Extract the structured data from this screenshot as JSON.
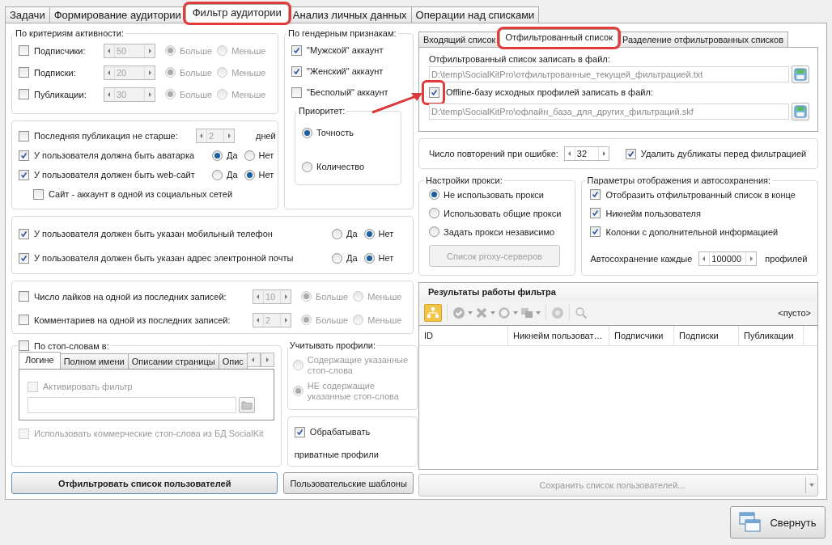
{
  "main_tabs": [
    {
      "label": "Задачи",
      "selected": false,
      "highlighted": false
    },
    {
      "label": "Формирование аудитории",
      "selected": false,
      "highlighted": false
    },
    {
      "label": "Фильтр аудитории",
      "selected": true,
      "highlighted": true
    },
    {
      "label": "Анализ личных данных",
      "selected": false,
      "highlighted": false
    },
    {
      "label": "Операции над списками",
      "selected": false,
      "highlighted": false
    }
  ],
  "activity": {
    "title": "По критериям активности:",
    "rows": [
      {
        "label": "Подписчики:",
        "checked": false,
        "value": "50",
        "options": [
          {
            "label": "Больше",
            "selected": true
          },
          {
            "label": "Меньше",
            "selected": false
          }
        ]
      },
      {
        "label": "Подписки:",
        "checked": false,
        "value": "20",
        "options": [
          {
            "label": "Больше",
            "selected": true
          },
          {
            "label": "Меньше",
            "selected": false
          }
        ]
      },
      {
        "label": "Публикации:",
        "checked": false,
        "value": "30",
        "options": [
          {
            "label": "Больше",
            "selected": true
          },
          {
            "label": "Меньше",
            "selected": false
          }
        ]
      }
    ]
  },
  "profile_rules": {
    "rows": [
      {
        "kind": "spinner",
        "label": "Последняя публикация не старше:",
        "checked": false,
        "value": "2",
        "unit": "дней"
      },
      {
        "kind": "choice",
        "label": "У пользователя должна быть аватарка",
        "checked": true,
        "options": [
          {
            "label": "Да",
            "selected": true
          },
          {
            "label": "Нет",
            "selected": false
          }
        ]
      },
      {
        "kind": "choice",
        "label": "У пользователя должен быть web-сайт",
        "checked": true,
        "options": [
          {
            "label": "Да",
            "selected": false
          },
          {
            "label": "Нет",
            "selected": true
          }
        ]
      },
      {
        "kind": "sub",
        "label": "Сайт - аккаунт в одной из социальных сетей",
        "checked": false
      }
    ]
  },
  "gender": {
    "title": "По гендерным признакам:",
    "options": [
      {
        "label": "\"Мужской\" аккаунт",
        "checked": true
      },
      {
        "label": "\"Женский\" аккаунт",
        "checked": true
      },
      {
        "label": "\"Бесполый\" аккаунт",
        "checked": false
      }
    ],
    "priority": {
      "title": "Приоритет:",
      "options": [
        {
          "label": "Точность",
          "selected": true
        },
        {
          "label": "Количество",
          "selected": false
        }
      ]
    }
  },
  "contacts": {
    "rows": [
      {
        "label": "У пользователя должен быть указан мобильный телефон",
        "checked": true,
        "options": [
          {
            "label": "Да",
            "selected": false
          },
          {
            "label": "Нет",
            "selected": true
          }
        ]
      },
      {
        "label": "У пользователя должен быть указан адрес электронной почты",
        "checked": true,
        "options": [
          {
            "label": "Да",
            "selected": false
          },
          {
            "label": "Нет",
            "selected": true
          }
        ]
      }
    ]
  },
  "engagement": {
    "rows": [
      {
        "label": "Число лайков на одной из последних записей:",
        "checked": false,
        "value": "10",
        "options": [
          {
            "label": "Больше",
            "selected": true
          },
          {
            "label": "Меньше",
            "selected": false
          }
        ]
      },
      {
        "label": "Комментариев на одной из последних записей:",
        "checked": false,
        "value": "2",
        "options": [
          {
            "label": "Больше",
            "selected": true
          },
          {
            "label": "Меньше",
            "selected": false
          }
        ]
      }
    ]
  },
  "stopwords": {
    "label": "По стоп-словам в:",
    "checked": false,
    "tabs": [
      {
        "label": "Логине",
        "selected": true
      },
      {
        "label": "Полном имени",
        "selected": false
      },
      {
        "label": "Описании страницы",
        "selected": false
      },
      {
        "label": "Опис",
        "selected": false
      }
    ],
    "activate": {
      "label": "Активировать фильтр",
      "checked": false
    },
    "commercial": {
      "label": "Использовать коммерческие стоп-слова из БД SocialKit",
      "checked": false
    }
  },
  "profiles": {
    "title": "Учитывать профили:",
    "options": [
      {
        "label": "Содержащие указанные стоп-слова",
        "selected": false
      },
      {
        "label": "НЕ содержащие указанные стоп-слова",
        "selected": true
      }
    ]
  },
  "private": {
    "label_1": "Обрабатывать",
    "label_2": "приватные профили",
    "checked": true
  },
  "filter_button": "Отфильтровать список пользователей",
  "templates_button": "Пользовательские шаблоны",
  "sub_tabs": [
    {
      "label": "Входящий список",
      "selected": false,
      "highlighted": false
    },
    {
      "label": "Отфильтрованный список",
      "selected": true,
      "highlighted": true
    },
    {
      "label": "Разделение отфильтрованных списков",
      "selected": false,
      "highlighted": false
    }
  ],
  "files": {
    "output_label": "Отфильтрованный список записать в файл:",
    "output_path": "D:\\temp\\SocialKitPro\\отфильтрованные_текущей_фильтрацией.txt",
    "offline": {
      "label": "Offline-базу исходных профилей записать в файл:",
      "checked": true,
      "highlighted": true
    },
    "offline_path": "D:\\temp\\SocialKitPro\\офлайн_база_для_других_фильтраций.skf"
  },
  "retry": {
    "label": "Число повторений при ошибке:",
    "value": "32",
    "dedupe": {
      "label": "Удалить дубликаты перед фильтрацией",
      "checked": true
    }
  },
  "proxy": {
    "title": "Настройки прокси:",
    "options": [
      {
        "label": "Не использовать прокси",
        "selected": true
      },
      {
        "label": "Использовать общие прокси",
        "selected": false
      },
      {
        "label": "Задать прокси независимо",
        "selected": false
      }
    ],
    "button": "Список proxy-серверов",
    "button_disabled": true
  },
  "display": {
    "title": "Параметры отображения и автосохранения:",
    "options": [
      {
        "label": "Отобразить отфильтрованный список в конце",
        "checked": true
      },
      {
        "label": "Никнейм пользователя",
        "checked": true
      },
      {
        "label": "Колонки с дополнительной информацией",
        "checked": true
      }
    ],
    "autosave": {
      "label": "Автосохранение каждые",
      "value": "100000",
      "unit": "профилей"
    }
  },
  "results": {
    "title": "Результаты работы фильтра",
    "status": "<пусто>",
    "columns": [
      "ID",
      "Никнейм пользоват…",
      "Подписчики",
      "Подписки",
      "Публикации"
    ]
  },
  "save_button": {
    "label": "Сохранить список пользователей...",
    "disabled": true
  },
  "minimize_button": "Свернуть"
}
